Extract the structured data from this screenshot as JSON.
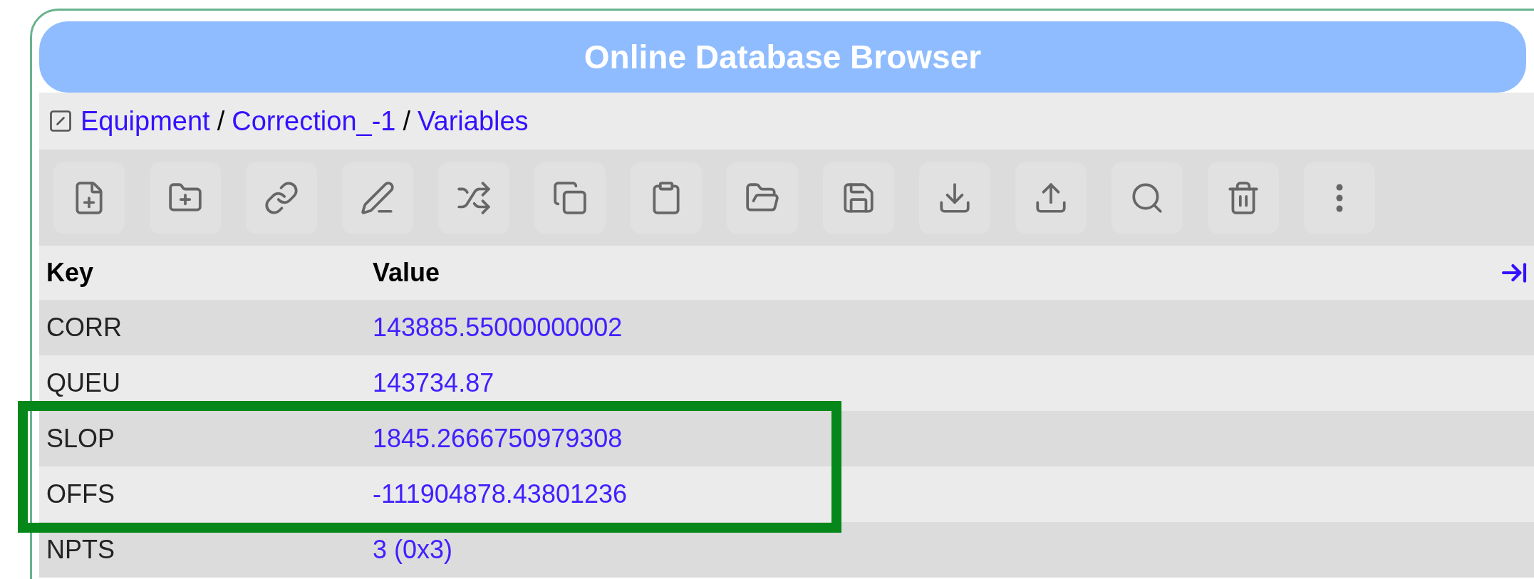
{
  "window": {
    "title": "Online Database Browser"
  },
  "breadcrumb": {
    "separator": "/",
    "items": [
      {
        "label": "Equipment"
      },
      {
        "label": "Correction_-1"
      },
      {
        "label": "Variables"
      }
    ]
  },
  "toolbar": [
    {
      "kind": "new-file"
    },
    {
      "kind": "new-folder"
    },
    {
      "kind": "link"
    },
    {
      "kind": "rename"
    },
    {
      "kind": "move"
    },
    {
      "kind": "copy"
    },
    {
      "kind": "paste"
    },
    {
      "kind": "open"
    },
    {
      "kind": "save"
    },
    {
      "kind": "import"
    },
    {
      "kind": "export"
    },
    {
      "kind": "find"
    },
    {
      "kind": "delete"
    },
    {
      "kind": "more"
    }
  ],
  "table": {
    "columns": [
      "Key",
      "Value"
    ],
    "rows": [
      {
        "key": "CORR",
        "value": "143885.55000000002",
        "highlighted": false
      },
      {
        "key": "QUEU",
        "value": "143734.87",
        "highlighted": false
      },
      {
        "key": "SLOP",
        "value": "1845.2666750979308",
        "highlighted": true
      },
      {
        "key": "OFFS",
        "value": "-111904878.43801236",
        "highlighted": true
      },
      {
        "key": "NPTS",
        "value": "3 (0x3)",
        "highlighted": false
      }
    ]
  }
}
